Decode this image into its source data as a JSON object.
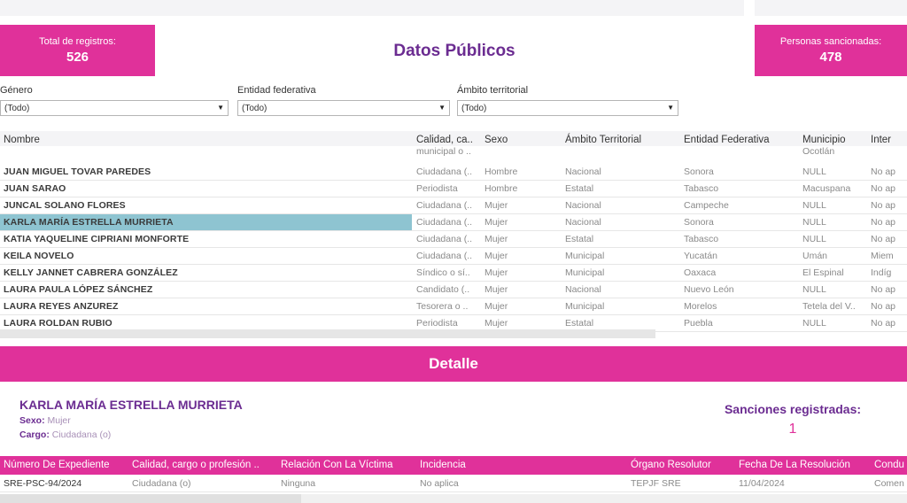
{
  "header": {
    "title": "Datos Públicos",
    "total_label": "Total de registros:",
    "total_value": "526",
    "sancionadas_label": "Personas sancionadas:",
    "sancionadas_value": "478",
    "accent_color": "#e0319a",
    "title_color": "#6b2c91"
  },
  "filters": [
    {
      "label": "Género",
      "value": "(Todo)"
    },
    {
      "label": "Entidad federativa",
      "value": "(Todo)"
    },
    {
      "label": "Ámbito territorial",
      "value": "(Todo)"
    }
  ],
  "table": {
    "columns": [
      "Nombre",
      "Calidad, ca..",
      "Sexo",
      "Ámbito Territorial",
      "Entidad Federativa",
      "Municipio",
      "Inter"
    ],
    "partial_row": {
      "calidad": "municipal o ..",
      "municipio": "Ocotlán"
    },
    "rows": [
      {
        "nombre": "JUAN MIGUEL TOVAR PAREDES",
        "calidad": "Ciudadana (..",
        "sexo": "Hombre",
        "ambito": "Nacional",
        "entidad": "Sonora",
        "municipio": "NULL",
        "inter": "No ap"
      },
      {
        "nombre": "JUAN SARAO",
        "calidad": "Periodista",
        "sexo": "Hombre",
        "ambito": "Estatal",
        "entidad": "Tabasco",
        "municipio": "Macuspana",
        "inter": "No ap"
      },
      {
        "nombre": "JUNCAL SOLANO FLORES",
        "calidad": "Ciudadana (..",
        "sexo": "Mujer",
        "ambito": "Nacional",
        "entidad": "Campeche",
        "municipio": "NULL",
        "inter": "No ap"
      },
      {
        "nombre": "KARLA MARÍA ESTRELLA MURRIETA",
        "calidad": "Ciudadana (..",
        "sexo": "Mujer",
        "ambito": "Nacional",
        "entidad": "Sonora",
        "municipio": "NULL",
        "inter": "No ap",
        "selected": true
      },
      {
        "nombre": "KATIA YAQUELINE CIPRIANI MONFORTE",
        "calidad": "Ciudadana (..",
        "sexo": "Mujer",
        "ambito": "Estatal",
        "entidad": "Tabasco",
        "municipio": "NULL",
        "inter": "No ap"
      },
      {
        "nombre": "KEILA NOVELO",
        "calidad": "Ciudadana (..",
        "sexo": "Mujer",
        "ambito": "Municipal",
        "entidad": "Yucatán",
        "municipio": "Umán",
        "inter": "Miem"
      },
      {
        "nombre": "KELLY JANNET CABRERA GONZÁLEZ",
        "calidad": "Síndico o sí..",
        "sexo": "Mujer",
        "ambito": "Municipal",
        "entidad": "Oaxaca",
        "municipio": "El Espinal",
        "inter": "Indíg"
      },
      {
        "nombre": "LAURA PAULA LÓPEZ SÁNCHEZ",
        "calidad": "Candidato (..",
        "sexo": "Mujer",
        "ambito": "Nacional",
        "entidad": "Nuevo León",
        "municipio": "NULL",
        "inter": "No ap"
      },
      {
        "nombre": "LAURA REYES ANZUREZ",
        "calidad": "Tesorera o ..",
        "sexo": "Mujer",
        "ambito": "Municipal",
        "entidad": "Morelos",
        "municipio": "Tetela del V..",
        "inter": "No ap"
      },
      {
        "nombre": "LAURA ROLDAN RUBIO",
        "calidad": "Periodista",
        "sexo": "Mujer",
        "ambito": "Estatal",
        "entidad": "Puebla",
        "municipio": "NULL",
        "inter": "No ap"
      }
    ]
  },
  "detalle": {
    "banner": "Detalle",
    "name": "KARLA MARÍA ESTRELLA MURRIETA",
    "sexo_label": "Sexo:",
    "sexo_value": "Mujer",
    "cargo_label": "Cargo:",
    "cargo_value": "Ciudadana (o)",
    "sanciones_label": "Sanciones registradas:",
    "sanciones_value": "1",
    "columns": [
      "Número De Expediente",
      "Calidad, cargo o profesión ..",
      "Relación Con La Víctima",
      "Incidencia",
      "Órgano Resolutor",
      "Fecha De La Resolución",
      "Condu"
    ],
    "row": [
      "SRE-PSC-94/2024",
      "Ciudadana (o)",
      "Ninguna",
      "No aplica",
      "TEPJF SRE",
      "11/04/2024",
      "Comen"
    ]
  }
}
